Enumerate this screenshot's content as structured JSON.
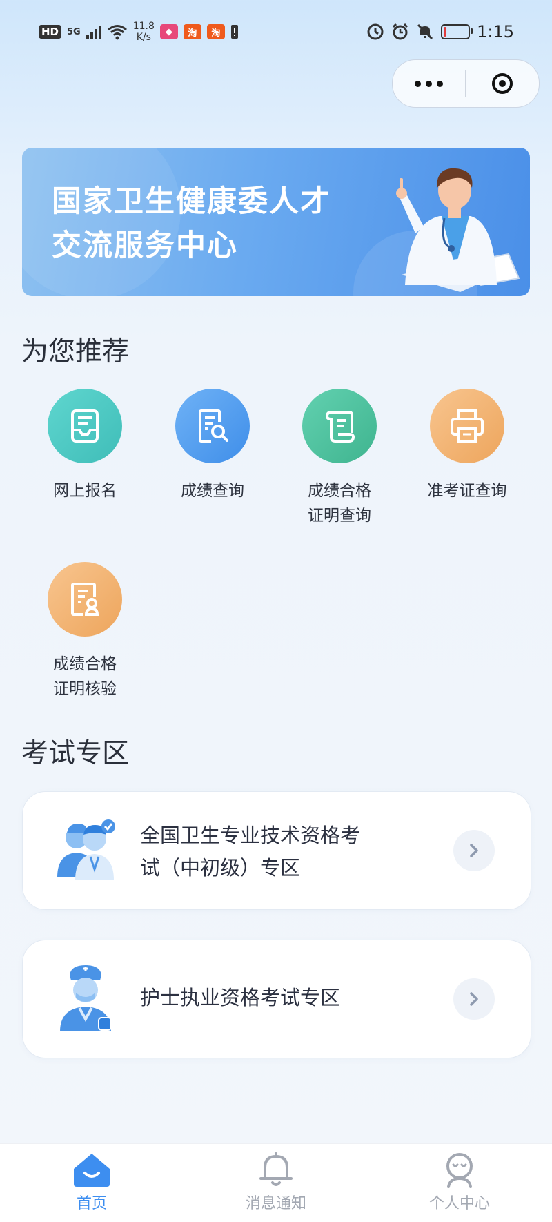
{
  "status_bar": {
    "hd": "HD",
    "network": "5G",
    "speed_value": "11.8",
    "speed_unit": "K/s",
    "time": "1:15",
    "battery_color": "#e03b3b",
    "icons": [
      "wifi-icon",
      "shopping-app-icon",
      "taobao-icon",
      "taobao-icon",
      "alert-icon",
      "data-saver-icon",
      "alarm-icon",
      "mute-icon",
      "battery-icon"
    ]
  },
  "capsule": {
    "more_icon": "more-dots-icon",
    "close_icon": "target-close-icon"
  },
  "banner": {
    "title_line1": "国家卫生健康委人才",
    "title_line2": "交流服务中心"
  },
  "recommend": {
    "title": "为您推荐",
    "items": [
      {
        "line1": "网上报名",
        "line2": "",
        "icon": "inbox-form-icon",
        "color": "#4fc9c3"
      },
      {
        "line1": "成绩查询",
        "line2": "",
        "icon": "document-search-icon",
        "color": "#4f9cf0"
      },
      {
        "line1": "成绩合格",
        "line2": "证明查询",
        "icon": "scroll-certificate-icon",
        "color": "#4ec2a0"
      },
      {
        "line1": "准考证查询",
        "line2": "",
        "icon": "printer-icon",
        "color": "#f3b574"
      },
      {
        "line1": "成绩合格",
        "line2": "证明核验",
        "icon": "certificate-verify-icon",
        "color": "#f3b574"
      }
    ]
  },
  "exam_zone": {
    "title": "考试专区",
    "cards": [
      {
        "line1": "全国卫生专业技术资格考",
        "line2": "试（中初级）专区",
        "icon": "medical-staff-icon"
      },
      {
        "line1": "护士执业资格考试专区",
        "line2": "",
        "icon": "nurse-icon"
      }
    ]
  },
  "tabbar": {
    "active_color": "#3d8ef0",
    "tabs": [
      {
        "label": "首页",
        "icon": "home-icon",
        "active": true
      },
      {
        "label": "消息通知",
        "icon": "bell-icon",
        "active": false
      },
      {
        "label": "个人中心",
        "icon": "profile-icon",
        "active": false
      }
    ]
  }
}
